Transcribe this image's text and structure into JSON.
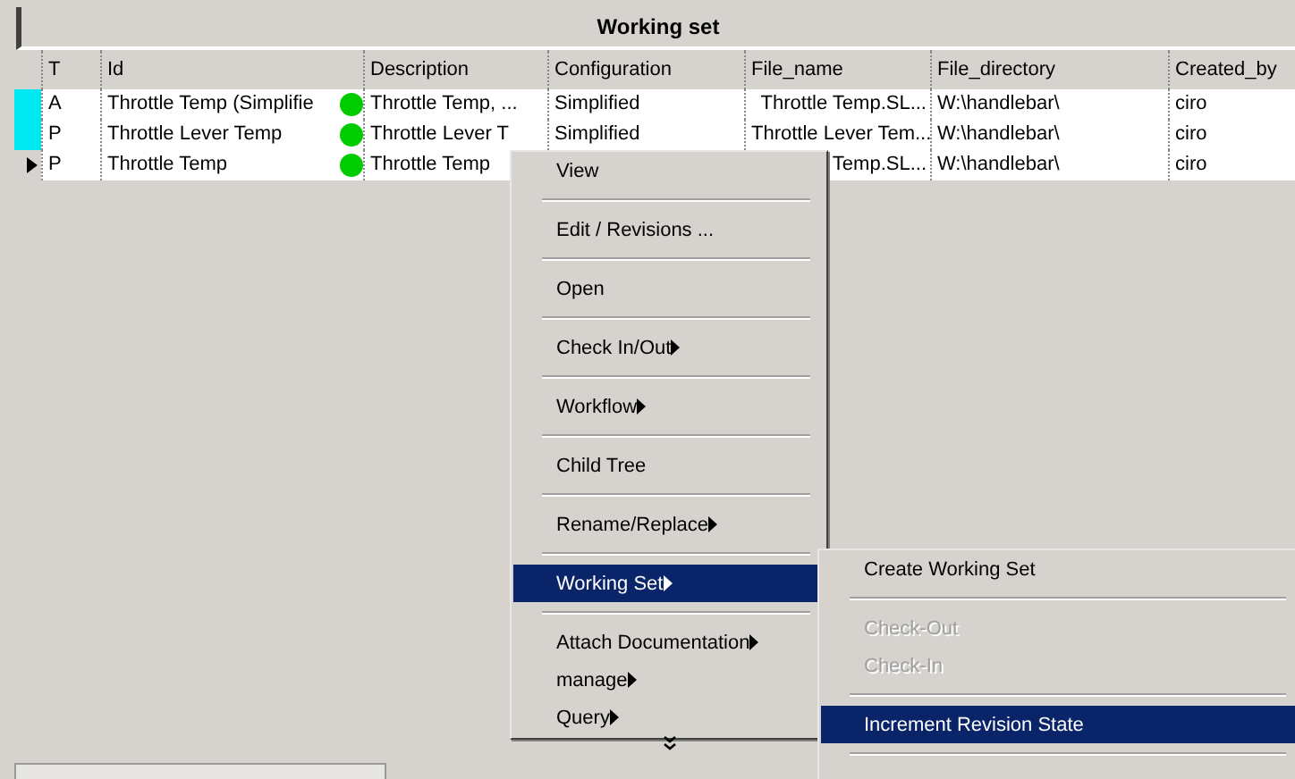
{
  "panel": {
    "title": "Working set"
  },
  "table": {
    "columns": [
      "T",
      "Id",
      "Description",
      "Configuration",
      "File_name",
      "File_directory",
      "Created_by"
    ],
    "rows": [
      {
        "marked": true,
        "current": false,
        "color": "#00cc00",
        "cells": [
          "A",
          "Throttle Temp (Simplifie",
          "Throttle Temp, ...",
          "Simplified",
          "Throttle Temp.SL...",
          "W:\\handlebar\\",
          "ciro"
        ]
      },
      {
        "marked": true,
        "current": false,
        "color": "#00cc00",
        "cells": [
          "P",
          "Throttle Lever Temp",
          "Throttle Lever T",
          "Simplified",
          "Throttle Lever Tem...",
          "W:\\handlebar\\",
          "ciro"
        ]
      },
      {
        "marked": false,
        "current": true,
        "color": "#00cc00",
        "cells": [
          "P",
          "Throttle Temp",
          "Throttle Temp",
          null,
          "Temp.SL...",
          "W:\\handlebar\\",
          "ciro"
        ]
      }
    ]
  },
  "context_menu": {
    "more": true,
    "groups": [
      [
        {
          "label": "View",
          "submenu": false,
          "selected": false,
          "disabled": false
        }
      ],
      [
        {
          "label": "Edit / Revisions ...",
          "submenu": false,
          "selected": false,
          "disabled": false
        }
      ],
      [
        {
          "label": "Open",
          "submenu": false,
          "selected": false,
          "disabled": false
        }
      ],
      [
        {
          "label": "Check In/Out",
          "submenu": true,
          "selected": false,
          "disabled": false
        }
      ],
      [
        {
          "label": "Workflow",
          "submenu": true,
          "selected": false,
          "disabled": false
        }
      ],
      [
        {
          "label": "Child Tree",
          "submenu": false,
          "selected": false,
          "disabled": false
        }
      ],
      [
        {
          "label": "Rename/Replace",
          "submenu": true,
          "selected": false,
          "disabled": false
        }
      ],
      [
        {
          "label": "Working Set",
          "submenu": true,
          "selected": true,
          "disabled": false
        }
      ],
      [
        {
          "label": "Attach Documentation",
          "submenu": true,
          "selected": false,
          "disabled": false
        },
        {
          "label": "manage",
          "submenu": true,
          "selected": false,
          "disabled": false
        },
        {
          "label": "Query",
          "submenu": true,
          "selected": false,
          "disabled": false
        }
      ]
    ]
  },
  "submenu": {
    "continues_below": true,
    "groups": [
      [
        {
          "label": "Create Working Set",
          "submenu": false,
          "selected": false,
          "disabled": false
        }
      ],
      [
        {
          "label": "Check-Out",
          "submenu": false,
          "selected": false,
          "disabled": true
        },
        {
          "label": "Check-In",
          "submenu": false,
          "selected": false,
          "disabled": true
        }
      ],
      [
        {
          "label": "Increment Revision State",
          "submenu": false,
          "selected": true,
          "disabled": false
        }
      ]
    ]
  }
}
